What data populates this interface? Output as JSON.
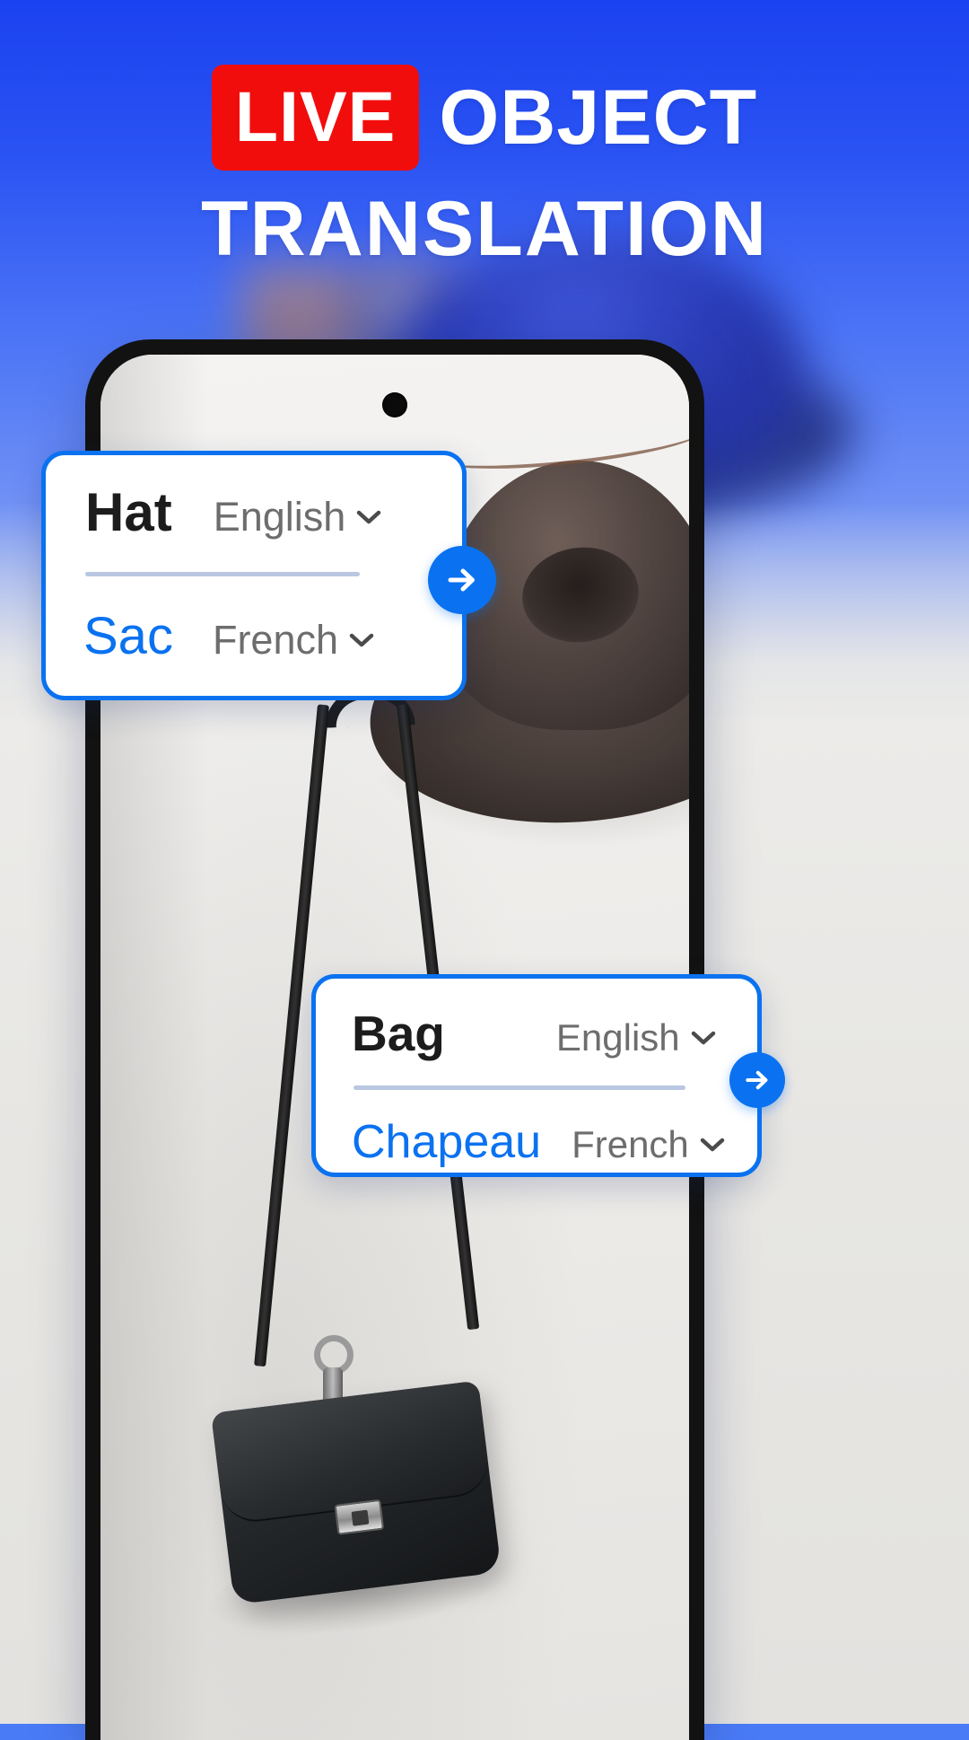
{
  "headline": {
    "badge": "LIVE",
    "word1": "OBJECT",
    "word2": "TRANSLATION"
  },
  "colors": {
    "accent_blue": "#0a72f0",
    "badge_red": "#f20d0d",
    "bg_blue": "#1b42f0",
    "divider": "#b9c7e2",
    "lang_gray": "#6d6d6d",
    "word_dark": "#1c1c1c"
  },
  "phone": {
    "camera_icon": "camera-punch-hole"
  },
  "scan_brackets": [
    {
      "target": "hat",
      "icon": "scan-bracket-icon"
    },
    {
      "target": "bag",
      "icon": "scan-bracket-icon"
    }
  ],
  "cards": [
    {
      "id": "hat",
      "source_word": "Hat",
      "source_language": "English",
      "target_word": "Sac",
      "target_language": "French",
      "chevron_icon": "chevron-down-icon",
      "go_icon": "arrow-right-icon"
    },
    {
      "id": "bag",
      "source_word": "Bag",
      "source_language": "English",
      "target_word": "Chapeau",
      "target_language": "French",
      "chevron_icon": "chevron-down-icon",
      "go_icon": "arrow-right-icon"
    }
  ]
}
